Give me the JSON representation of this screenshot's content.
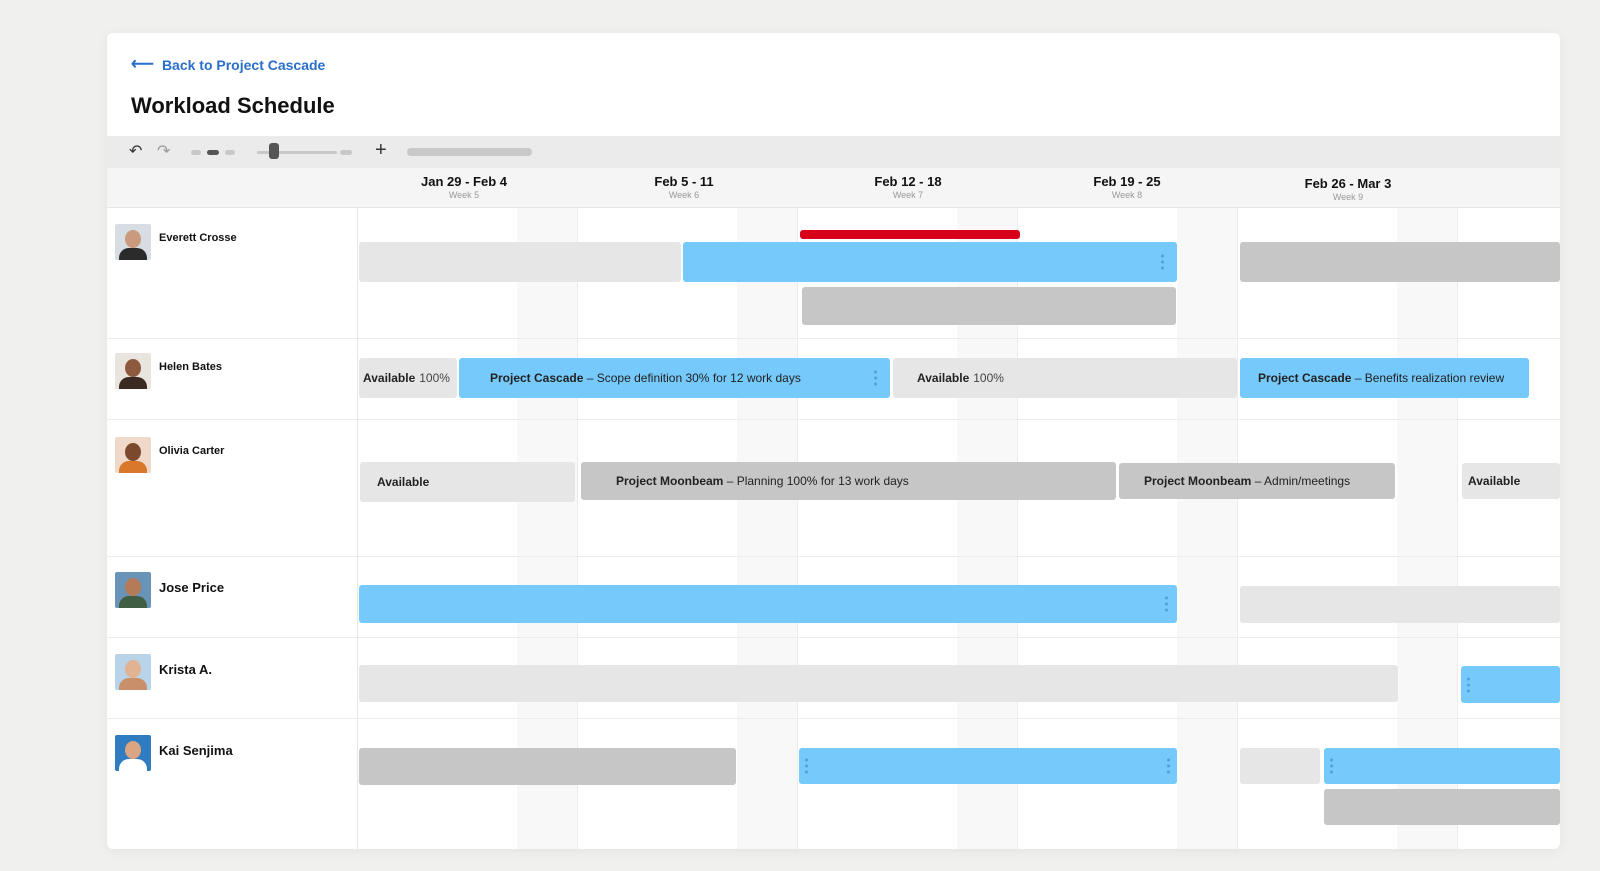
{
  "nav": {
    "back_label": "Back to Project Cascade",
    "back_icon": "arrow-left-icon"
  },
  "page": {
    "title": "Workload Schedule"
  },
  "toolbar": {
    "undo_icon": "undo-icon",
    "redo_icon": "redo-icon",
    "zoom_in_icon": "plus-icon"
  },
  "weeks": [
    {
      "range": "Jan 29 - Feb 4",
      "week": "Week 5"
    },
    {
      "range": "Feb 5 - 11",
      "week": "Week 6"
    },
    {
      "range": "Feb 12 - 18",
      "week": "Week 7"
    },
    {
      "range": "Feb 19 - 25",
      "week": "Week 8"
    },
    {
      "range": "Feb 26 - Mar 3",
      "week": "Week 9"
    }
  ],
  "people": [
    {
      "name": "Everett Crosse"
    },
    {
      "name": "Helen Bates"
    },
    {
      "name": "Olivia Carter"
    },
    {
      "name": "Jose Price"
    },
    {
      "name": "Krista A."
    },
    {
      "name": "Kai Senjima"
    }
  ],
  "assignments": {
    "helen_available_1": {
      "label": "Available",
      "pct": "100%"
    },
    "helen_cascade_scope": {
      "project": "Project Cascade",
      "detail": " – Scope definition 30% for 12 work days"
    },
    "helen_available_2": {
      "label": "Available",
      "pct": "100%"
    },
    "helen_cascade_benefits": {
      "project": "Project Cascade",
      "detail": " – Benefits realization review"
    },
    "olivia_available_1": {
      "label": "Available"
    },
    "olivia_moonbeam_planning": {
      "project": "Project Moonbeam",
      "detail": " – Planning 100% for 13 work days"
    },
    "olivia_moonbeam_admin": {
      "project": "Project Moonbeam",
      "detail": " – Admin/meetings"
    },
    "olivia_available_2": {
      "label": "Available"
    }
  },
  "colors": {
    "assigned": "#75c9fb",
    "available": "#e6e6e6",
    "other_project": "#c6c6c6",
    "overallocated": "#d9001b",
    "link": "#2a6fc9"
  }
}
